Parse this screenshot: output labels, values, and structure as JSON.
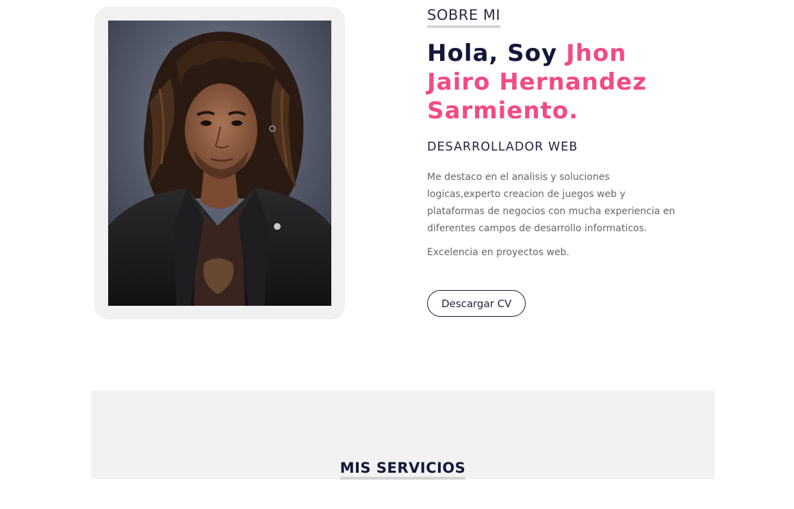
{
  "about": {
    "section_label": "SOBRE MI",
    "greeting": "Hola, Soy ",
    "name": "Jhon Jairo Hernandez Sarmiento.",
    "role": "DESARROLLADOR WEB",
    "description": "Me destaco en el analisis y soluciones logicas,experto creacion de juegos web y plataformas de negocios con mucha experiencia en diferentes campos de desarrollo informaticos.",
    "tagline": "Excelencia en proyectos web.",
    "cv_button": "Descargar CV"
  },
  "services": {
    "title": "MIS SERVICIOS"
  },
  "colors": {
    "accent": "#f24b82",
    "navy": "#14163a",
    "card_bg": "#f1f1f1",
    "section_bg": "#f2f2f2"
  }
}
